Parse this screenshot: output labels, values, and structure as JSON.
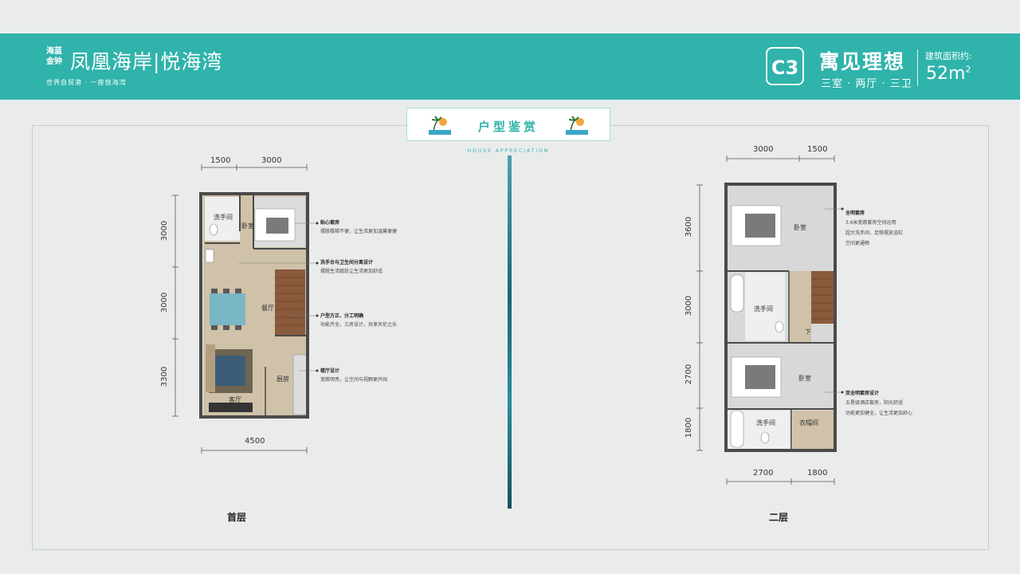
{
  "header": {
    "logo_small": "海蓝金钟",
    "logo_main": "凤凰海岸|悦海湾",
    "logo_sub": "世界自贸港 · 一座悦海湾",
    "code": "C3",
    "title": "寓见理想",
    "rooms": "三室 · 两厅 · 三卫",
    "area_label": "建筑面积约:",
    "area_value": "52m",
    "area_unit_sup": "2"
  },
  "banner": {
    "title": "户型鉴赏",
    "subtitle": "HOUSE APPRECIATION"
  },
  "floor1": {
    "label": "首层",
    "dims_top": [
      "1500",
      "3000"
    ],
    "dims_left": [
      "3000",
      "3000",
      "3300"
    ],
    "dim_bottom": "4500",
    "rooms": {
      "bath": "洗手间",
      "bedroom": "卧室",
      "dining": "餐厅",
      "kitchen": "厨房",
      "living": "客厅"
    },
    "notes": [
      {
        "title": "贴心套房",
        "text": "摆脱楼梯不便，让生活更加温馨便捷"
      },
      {
        "title": "洗手台与卫生间分离设计",
        "text": "摆脱生活尴尬让生活更加舒适"
      },
      {
        "title": "户型方正、分工明确",
        "text": "功能齐全，三房设计，共享天伦之乐"
      },
      {
        "title": "楼厅设计",
        "text": "宽敞明亮，让空间与视野更开阔"
      }
    ]
  },
  "floor2": {
    "label": "二层",
    "dims_top": [
      "3000",
      "1500"
    ],
    "dims_left": [
      "3600",
      "3000",
      "2700",
      "1800"
    ],
    "dims_bottom": [
      "2700",
      "1800"
    ],
    "rooms": {
      "bedroom1": "卧室",
      "bath1": "洗手间",
      "down": "下",
      "bedroom2": "卧室",
      "bath2": "洗手间",
      "cloak": "衣帽间"
    },
    "notes": [
      {
        "title": "全明套房",
        "text": [
          "3.6米宽敞套房空间运用",
          "超大洗手间，足够摆放浴缸",
          "空间更通畅"
        ]
      },
      {
        "title": "双全明套房设计",
        "text": [
          "五星级酒店套房，阳光舒适",
          "功能更加健全，让生活更加舒心"
        ]
      }
    ]
  },
  "colors": {
    "brand_teal": "#2fb3ab",
    "wall": "#4a4a4a",
    "floor_wood": "#c9b79a",
    "stairs": "#8a5a3c"
  }
}
